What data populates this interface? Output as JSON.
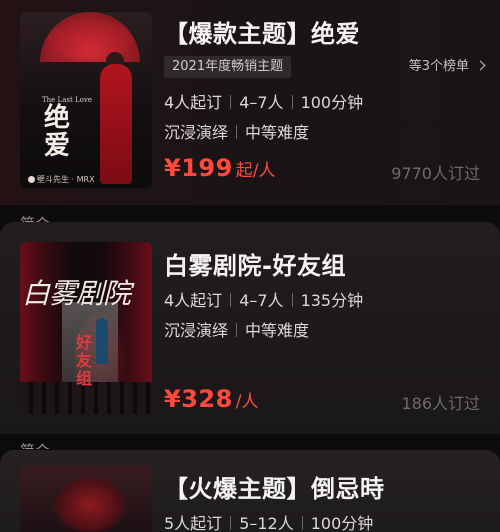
{
  "items": [
    {
      "title": "【爆款主题】绝爱",
      "rank_tag": "2021年度畅销主题",
      "rank_more": "等3个榜单",
      "players_min": "4人起订",
      "players_range": "4–7人",
      "duration": "100分钟",
      "style": "沉浸演绎",
      "difficulty": "中等难度",
      "price": "¥199",
      "price_unit": "起/人",
      "orders": "9770人订过",
      "poster": {
        "vertical_title": "绝爱",
        "subtitle": "The Last Love",
        "credit": "壁斗先生 · MRX"
      }
    },
    {
      "title": "白雾剧院-好友组",
      "players_min": "4人起订",
      "players_range": "4–7人",
      "duration": "135分钟",
      "style": "沉浸演绎",
      "difficulty": "中等难度",
      "price": "¥328",
      "price_unit": "/人",
      "orders": "186人订过",
      "poster": {
        "title": "白雾剧院",
        "red_vertical": "好友组"
      }
    },
    {
      "title": "【火爆主题】倒忌時",
      "players_min": "5人起订",
      "players_range": "5–12人",
      "duration": "100分钟"
    }
  ],
  "section_label": "简介",
  "colors": {
    "price": "#ff4a3d",
    "title": "#f5f3f1",
    "muted": "#6f6a6c"
  }
}
